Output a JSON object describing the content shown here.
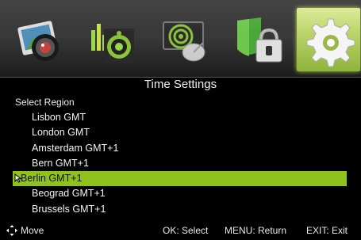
{
  "menu_tabs": [
    {
      "name": "picture",
      "icon": "photo-camera-icon",
      "selected": false
    },
    {
      "name": "sound",
      "icon": "speaker-icon",
      "selected": false
    },
    {
      "name": "channel",
      "icon": "satellite-dish-icon",
      "selected": false
    },
    {
      "name": "lock",
      "icon": "padlock-shield-icon",
      "selected": false
    },
    {
      "name": "setup",
      "icon": "gear-icon",
      "selected": true
    }
  ],
  "header": {
    "title": "Time Settings",
    "subtitle": "Select Region"
  },
  "regions": [
    {
      "label": "Lisbon GMT"
    },
    {
      "label": "London GMT"
    },
    {
      "label": "Amsterdam GMT+1"
    },
    {
      "label": "Bern GMT+1"
    },
    {
      "label": "Berlin GMT+1"
    },
    {
      "label": "Beograd GMT+1"
    },
    {
      "label": "Brussels GMT+1"
    }
  ],
  "selected_index": 4,
  "footer": {
    "move": "Move",
    "ok": "OK: Select",
    "menu": "MENU: Return",
    "exit": "EXIT: Exit"
  },
  "colors": {
    "highlight": "#8fc21c",
    "background": "#000000",
    "active_tab": "#b9d84a"
  }
}
